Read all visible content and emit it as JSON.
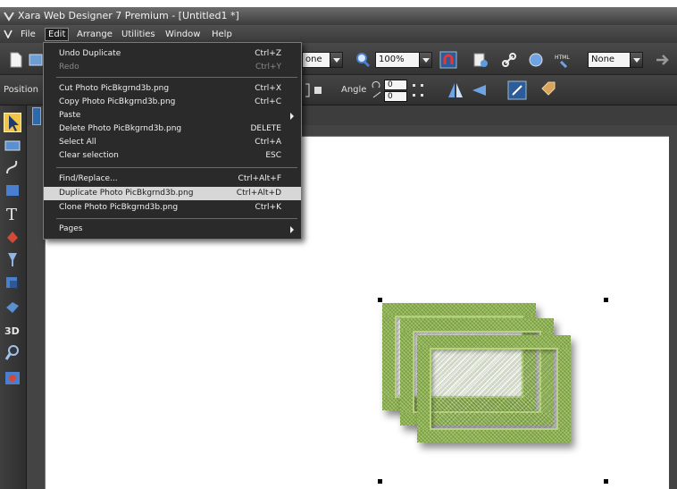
{
  "window": {
    "title": "Xara Web Designer 7 Premium - [Untitled1 *]"
  },
  "menubar": {
    "items": [
      {
        "label": "File"
      },
      {
        "label": "Edit"
      },
      {
        "label": "Arrange"
      },
      {
        "label": "Utilities"
      },
      {
        "label": "Window"
      },
      {
        "label": "Help"
      }
    ]
  },
  "toolbar": {
    "quality_combo": "one",
    "zoom_combo": "100%",
    "right_combo": "None"
  },
  "infobar": {
    "position_label": "Position",
    "angle_label": "Angle",
    "angle_value_1": "0",
    "angle_value_2": "0"
  },
  "edit_menu": {
    "items": [
      {
        "label": "Undo Duplicate",
        "shortcut": "Ctrl+Z",
        "state": "enabled"
      },
      {
        "label": "Redo",
        "shortcut": "Ctrl+Y",
        "state": "disabled"
      },
      {
        "label": "Cut Photo PicBkgrnd3b.png",
        "shortcut": "Ctrl+X",
        "state": "enabled"
      },
      {
        "label": "Copy Photo PicBkgrnd3b.png",
        "shortcut": "Ctrl+C",
        "state": "enabled"
      },
      {
        "label": "Paste",
        "shortcut": "",
        "state": "submenu"
      },
      {
        "label": "Delete Photo PicBkgrnd3b.png",
        "shortcut": "DELETE",
        "state": "enabled"
      },
      {
        "label": "Select All",
        "shortcut": "Ctrl+A",
        "state": "enabled"
      },
      {
        "label": "Clear selection",
        "shortcut": "ESC",
        "state": "enabled"
      },
      {
        "label": "Find/Replace...",
        "shortcut": "Ctrl+Alt+F",
        "state": "enabled"
      },
      {
        "label": "Duplicate Photo PicBkgrnd3b.png",
        "shortcut": "Ctrl+Alt+D",
        "state": "highlighted"
      },
      {
        "label": "Clone Photo PicBkgrnd3b.png",
        "shortcut": "Ctrl+K",
        "state": "enabled"
      },
      {
        "label": "Pages",
        "shortcut": "",
        "state": "submenu"
      }
    ]
  },
  "colors": {
    "frame_green": "#8fb356",
    "highlight": "#d7d7d7",
    "ui_dark": "#333333",
    "selected_tool": "#f2c44a"
  },
  "icons": {
    "toolbox": [
      "selector-icon",
      "zoom-icon",
      "freehand-icon",
      "rectangle-icon",
      "text-icon",
      "fill-icon",
      "transparency-icon",
      "shadow-icon",
      "bevel-icon",
      "3d-icon",
      "magnify-icon",
      "photo-icon"
    ]
  }
}
